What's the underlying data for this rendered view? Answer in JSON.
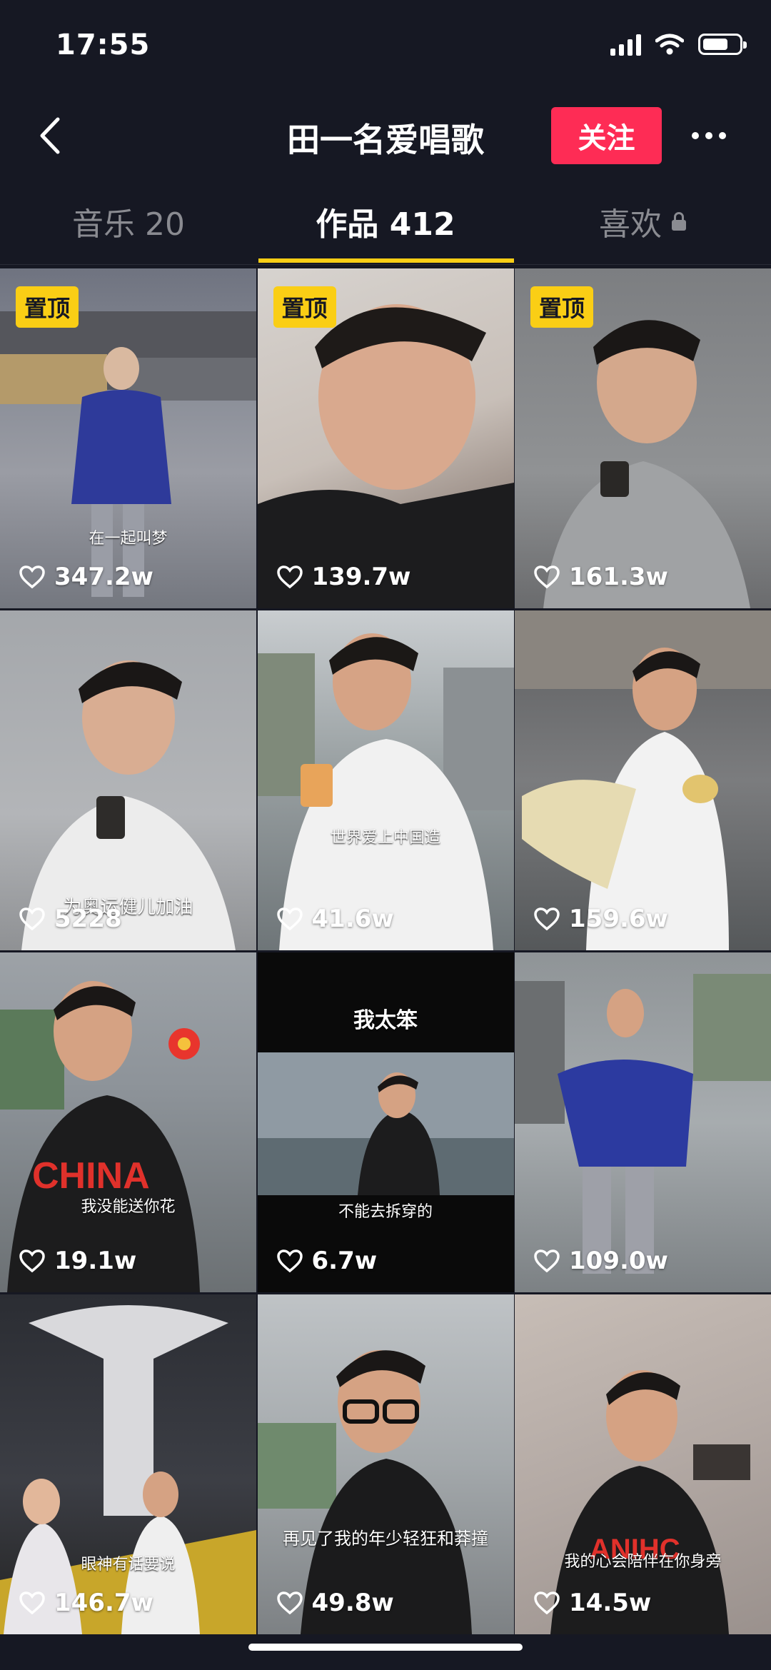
{
  "status_bar": {
    "time": "17:55",
    "battery_level": 0.7
  },
  "header": {
    "title": "田一名爱唱歌",
    "follow_label": "关注"
  },
  "tabs": [
    {
      "label": "音乐 20",
      "active": false
    },
    {
      "label": "作品 412",
      "active": true
    },
    {
      "label": "喜欢",
      "active": false,
      "locked": true
    }
  ],
  "colors": {
    "background": "#161823",
    "accent": "#FE2C55",
    "tab_indicator": "#FACE15",
    "pin_badge": "#FACE15"
  },
  "videos": [
    {
      "likes": "347.2w",
      "pinned": "置顶",
      "caption": "在一起叫梦"
    },
    {
      "likes": "139.7w",
      "pinned": "置顶"
    },
    {
      "likes": "161.3w",
      "pinned": "置顶"
    },
    {
      "likes": "5228",
      "caption": "为奥运健儿加油"
    },
    {
      "likes": "41.6w",
      "caption": "世界爱上中国造"
    },
    {
      "likes": "159.6w"
    },
    {
      "likes": "19.1w",
      "caption": "我没能送你花"
    },
    {
      "likes": "6.7w",
      "title_text": "我太笨",
      "caption": "不能去拆穿的"
    },
    {
      "likes": "109.0w"
    },
    {
      "likes": "146.7w",
      "caption": "眼神有话要说"
    },
    {
      "likes": "49.8w",
      "caption": "再见了我的年少轻狂和莽撞"
    },
    {
      "likes": "14.5w",
      "caption": "我的心会陪伴在你身旁"
    }
  ]
}
